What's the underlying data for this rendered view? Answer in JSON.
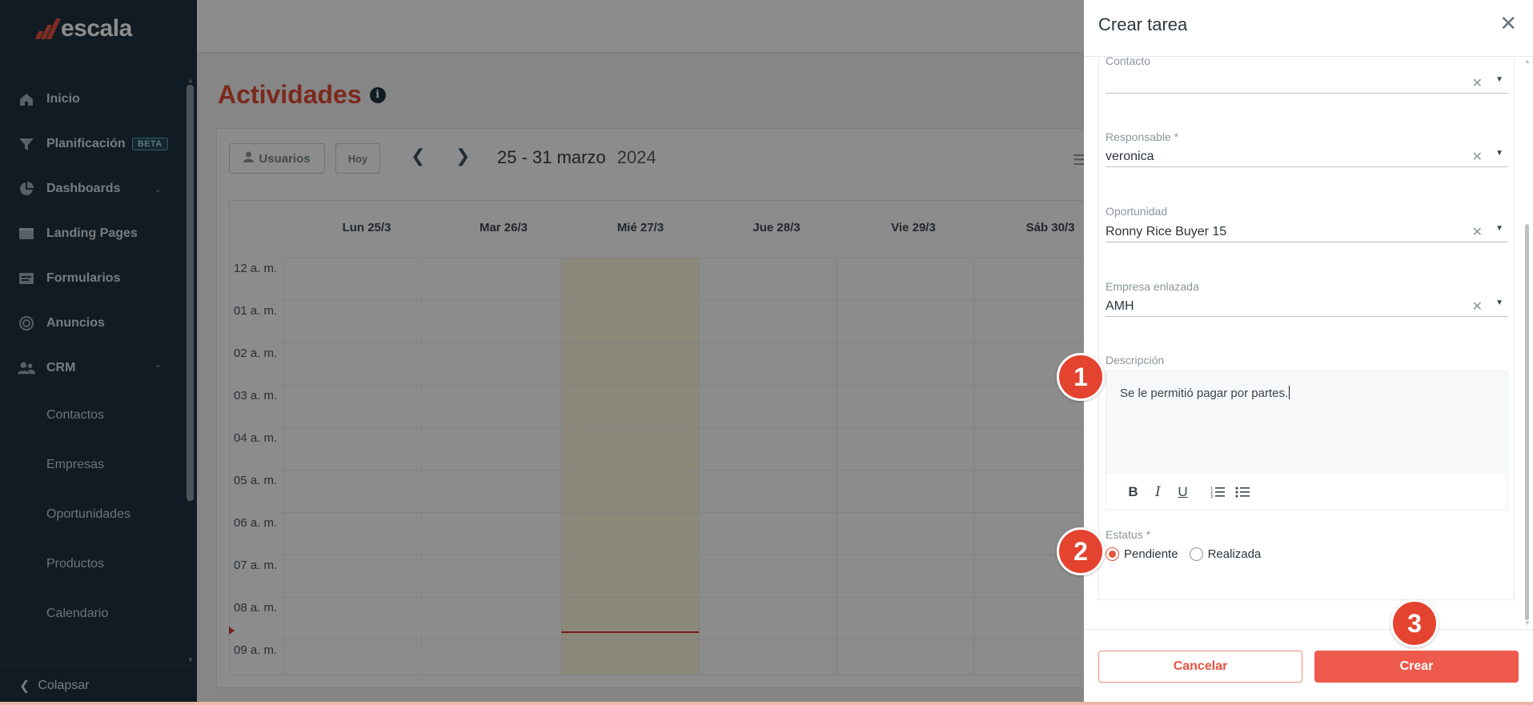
{
  "brand": {
    "name": "escala",
    "accent": "#e14b36"
  },
  "sidebar": {
    "items": [
      {
        "label": "Inicio",
        "icon": "home-icon"
      },
      {
        "label": "Planificación",
        "icon": "filter-icon",
        "badge": "BETA"
      },
      {
        "label": "Dashboards",
        "icon": "pie-chart-icon"
      },
      {
        "label": "Landing Pages",
        "icon": "browser-icon"
      },
      {
        "label": "Formularios",
        "icon": "form-icon"
      },
      {
        "label": "Anuncios",
        "icon": "target-icon"
      },
      {
        "label": "CRM",
        "icon": "users-icon"
      }
    ],
    "crm_sub": [
      "Contactos",
      "Empresas",
      "Oportunidades",
      "Productos",
      "Calendario"
    ],
    "collapse_label": "Colapsar"
  },
  "main": {
    "title": "Actividades",
    "users_button": "Usuarios",
    "today_button": "Hoy",
    "date_range": "25 - 31 marzo",
    "year": "2024",
    "days": [
      "Lun 25/3",
      "Mar 26/3",
      "Mié 27/3",
      "Jue 28/3",
      "Vie 29/3",
      "Sáb 30/3"
    ],
    "hours": [
      "12 a. m.",
      "01 a. m.",
      "02 a. m.",
      "03 a. m.",
      "04 a. m.",
      "05 a. m.",
      "06 a. m.",
      "07 a. m.",
      "08 a. m.",
      "09 a. m."
    ]
  },
  "drawer": {
    "title": "Crear tarea",
    "fields": {
      "contacto": {
        "label": "Contacto",
        "value": ""
      },
      "responsable": {
        "label": "Responsable *",
        "value": "veronica"
      },
      "oportunidad": {
        "label": "Oportunidad",
        "value": "Ronny Rice Buyer 15"
      },
      "empresa": {
        "label": "Empresa enlazada",
        "value": "AMH"
      }
    },
    "descripcion": {
      "label": "Descripción",
      "value": "Se le permitió pagar por partes."
    },
    "toolbar": {
      "bold": "B",
      "italic": "I",
      "underline": "U"
    },
    "estatus": {
      "label": "Estatus *",
      "options": [
        "Pendiente",
        "Realizada"
      ],
      "selected": "Pendiente"
    },
    "cancel_label": "Cancelar",
    "create_label": "Crear"
  },
  "steps": [
    "1",
    "2",
    "3"
  ]
}
